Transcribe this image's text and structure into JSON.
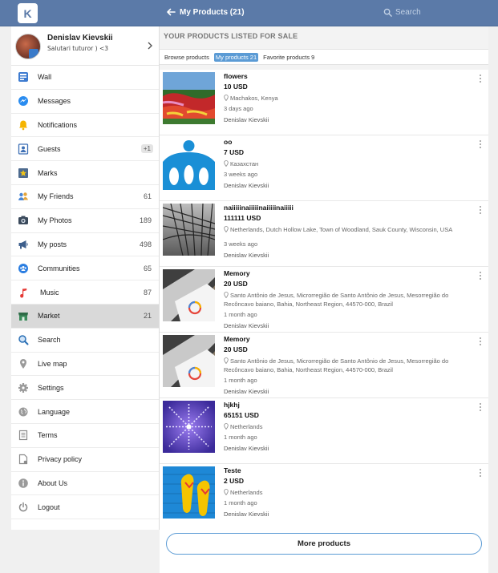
{
  "topbar": {
    "logo_letter": "K",
    "title": "My Products (21)",
    "search_placeholder": "Search"
  },
  "profile": {
    "name": "Denislav Kievskii",
    "status": "Salutari tuturor ) <3"
  },
  "sidebar": {
    "items": [
      {
        "label": "Wall",
        "icon": "wall-icon",
        "count": ""
      },
      {
        "label": "Messages",
        "icon": "messenger-icon",
        "count": ""
      },
      {
        "label": "Notifications",
        "icon": "bell-icon",
        "count": ""
      },
      {
        "label": "Guests",
        "icon": "guests-icon",
        "count": "+1"
      },
      {
        "label": "Marks",
        "icon": "star-icon",
        "count": ""
      },
      {
        "label": "My Friends",
        "icon": "friends-icon",
        "count": "61"
      },
      {
        "label": "My Photos",
        "icon": "camera-icon",
        "count": "189"
      },
      {
        "label": "My posts",
        "icon": "megaphone-icon",
        "count": "498"
      },
      {
        "label": "Communities",
        "icon": "communities-icon",
        "count": "65"
      },
      {
        "label": "Music",
        "icon": "music-note-icon",
        "count": "87"
      },
      {
        "label": "Market",
        "icon": "store-icon",
        "count": "21"
      },
      {
        "label": "Search",
        "icon": "search-icon",
        "count": ""
      },
      {
        "label": "Live map",
        "icon": "map-pin-icon",
        "count": ""
      },
      {
        "label": "Settings",
        "icon": "gear-icon",
        "count": ""
      },
      {
        "label": "Language",
        "icon": "globe-icon",
        "count": ""
      },
      {
        "label": "Terms",
        "icon": "document-icon",
        "count": ""
      },
      {
        "label": "Privacy policy",
        "icon": "privacy-document-icon",
        "count": ""
      },
      {
        "label": "About Us",
        "icon": "info-icon",
        "count": ""
      },
      {
        "label": "Logout",
        "icon": "power-icon",
        "count": ""
      }
    ]
  },
  "main": {
    "section_title": "YOUR PRODUCTS LISTED FOR SALE",
    "tabs": [
      {
        "label": "Browse products"
      },
      {
        "label": "My products 21"
      },
      {
        "label": "Favorite products 9"
      }
    ],
    "products": [
      {
        "name": "flowers",
        "price": "10 USD",
        "location": "Machakos, Kenya",
        "time": "3 days ago",
        "author": "Denislav Kievskii"
      },
      {
        "name": "oo",
        "price": "7 USD",
        "location": "Казахстан",
        "time": "3 weeks ago",
        "author": "Denislav Kievskii"
      },
      {
        "name": "naiiiiinaiiiiinaiiiiinaiiiii",
        "price": "111111 USD",
        "location": "Netherlands, Dutch Hollow Lake, Town of Woodland, Sauk County, Wisconsin, USA",
        "time": "3 weeks ago",
        "author": "Denislav Kievskii"
      },
      {
        "name": "Memory",
        "price": "20 USD",
        "location": "Santo Antônio de Jesus, Microrregião de Santo Antônio de Jesus, Mesorregião do Recôncavo baiano, Bahia, Northeast Region, 44570-000, Brazil",
        "time": "1 month ago",
        "author": "Denislav Kievskii"
      },
      {
        "name": "Memory",
        "price": "20 USD",
        "location": "Santo Antônio de Jesus, Microrregião de Santo Antônio de Jesus, Mesorregião do Recôncavo baiano, Bahia, Northeast Region, 44570-000, Brazil",
        "time": "1 month ago",
        "author": "Denislav Kievskii"
      },
      {
        "name": "hjkhj",
        "price": "65151 USD",
        "location": "Netherlands",
        "time": "1 month ago",
        "author": "Denislav Kievskii"
      },
      {
        "name": "Teste",
        "price": "2 USD",
        "location": "Netherlands",
        "time": "1 month ago",
        "author": "Denislav Kievskii"
      }
    ],
    "more_button": "More products"
  },
  "colors": {
    "topbar": "#5b7aa8",
    "accent": "#5b9bd5"
  }
}
